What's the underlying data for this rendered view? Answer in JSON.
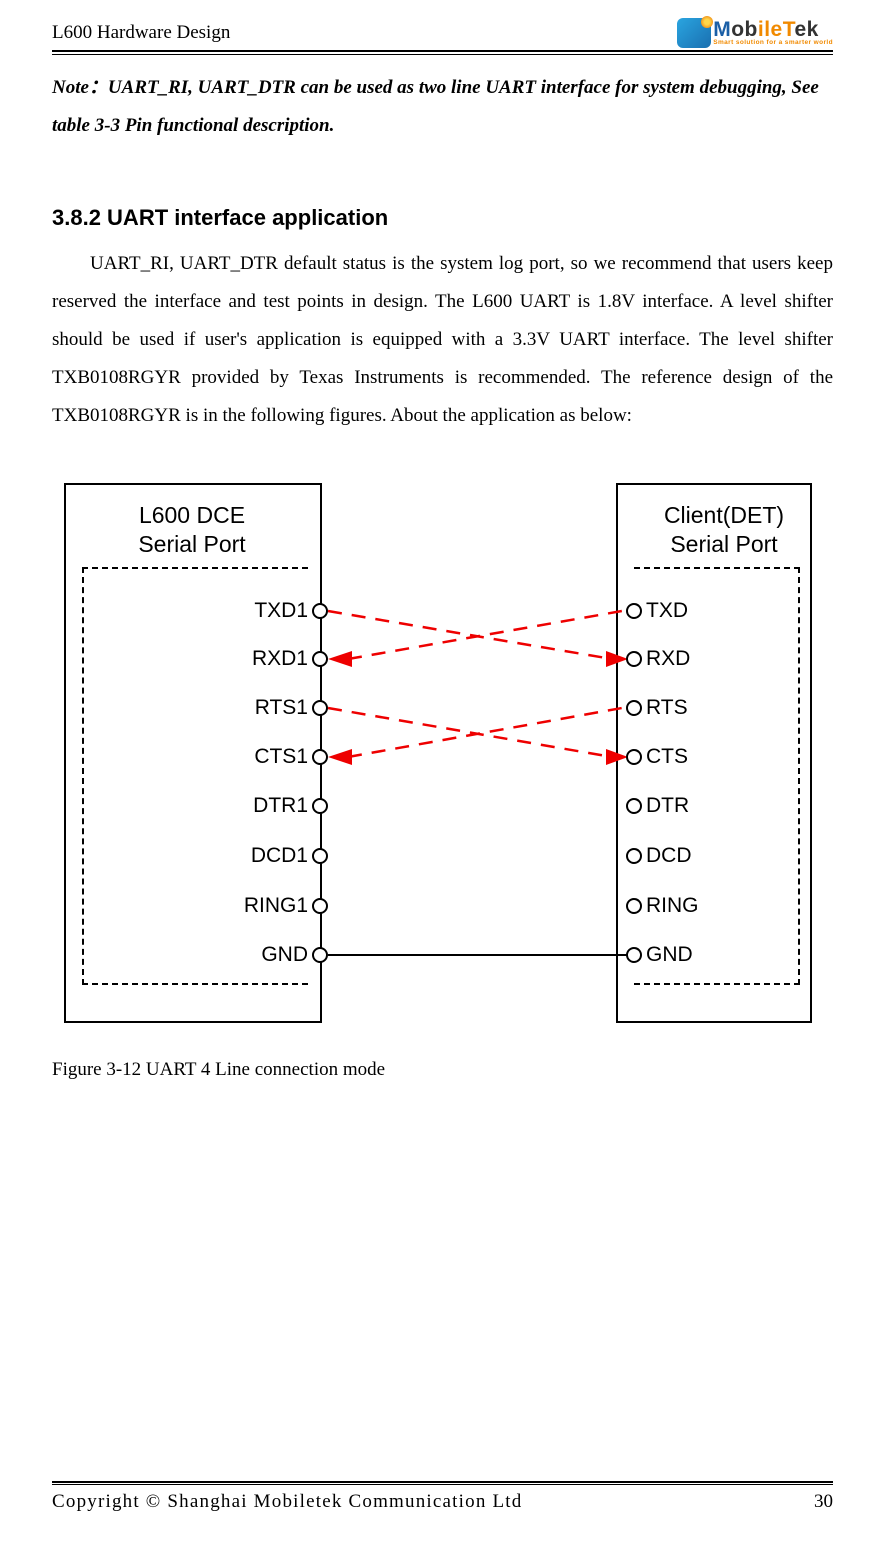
{
  "header": {
    "doc_title": "L600 Hardware Design",
    "logo_name_parts": {
      "a": "M",
      "b": "ob",
      "c": "ileT",
      "d": "ek"
    },
    "logo_tagline": "Smart solution for a smarter world"
  },
  "note": {
    "text": "Note：UART_RI, UART_DTR can be used as two line UART interface for system debugging, See table 3-3 Pin functional description."
  },
  "section": {
    "heading": "3.8.2 UART interface application",
    "body": "UART_RI, UART_DTR default status is the system log port, so we recommend that users keep reserved the interface and test points in design. The L600 UART is 1.8V interface. A level shifter should be used if user's application is equipped with a 3.3V UART interface. The level shifter TXB0108RGYR provided by Texas Instruments is recommended. The reference design of the TXB0108RGYR is in the following figures. About the application as below:"
  },
  "figure": {
    "left_title_1": "L600 DCE",
    "left_title_2": "Serial Port",
    "right_title_1": "Client(DET)",
    "right_title_2": "Serial Port",
    "left_pins": [
      "TXD1",
      "RXD1",
      "RTS1",
      "CTS1",
      "DTR1",
      "DCD1",
      "RING1",
      "GND"
    ],
    "right_pins": [
      "TXD",
      "RXD",
      "RTS",
      "CTS",
      "DTR",
      "DCD",
      "RING",
      "GND"
    ],
    "caption": "Figure 3-12 UART 4 Line connection mode"
  },
  "footer": {
    "copyright": "Copyright © Shanghai Mobiletek Communication Ltd",
    "page": "30"
  },
  "chart_data": {
    "type": "diagram",
    "title": "UART 4 Line connection mode",
    "left_block": {
      "name": "L600 DCE Serial Port",
      "pins": [
        "TXD1",
        "RXD1",
        "RTS1",
        "CTS1",
        "DTR1",
        "DCD1",
        "RING1",
        "GND"
      ]
    },
    "right_block": {
      "name": "Client(DET) Serial Port",
      "pins": [
        "TXD",
        "RXD",
        "RTS",
        "CTS",
        "DTR",
        "DCD",
        "RING",
        "GND"
      ]
    },
    "connections": [
      {
        "from": "TXD1",
        "to": "RXD",
        "style": "crossed-red-dashed",
        "direction": "to-right"
      },
      {
        "from": "RXD1",
        "to": "TXD",
        "style": "crossed-red-dashed",
        "direction": "to-left"
      },
      {
        "from": "RTS1",
        "to": "CTS",
        "style": "crossed-red-dashed",
        "direction": "to-right"
      },
      {
        "from": "CTS1",
        "to": "RTS",
        "style": "crossed-red-dashed",
        "direction": "to-left"
      },
      {
        "from": "GND",
        "to": "GND",
        "style": "solid-black"
      }
    ]
  }
}
